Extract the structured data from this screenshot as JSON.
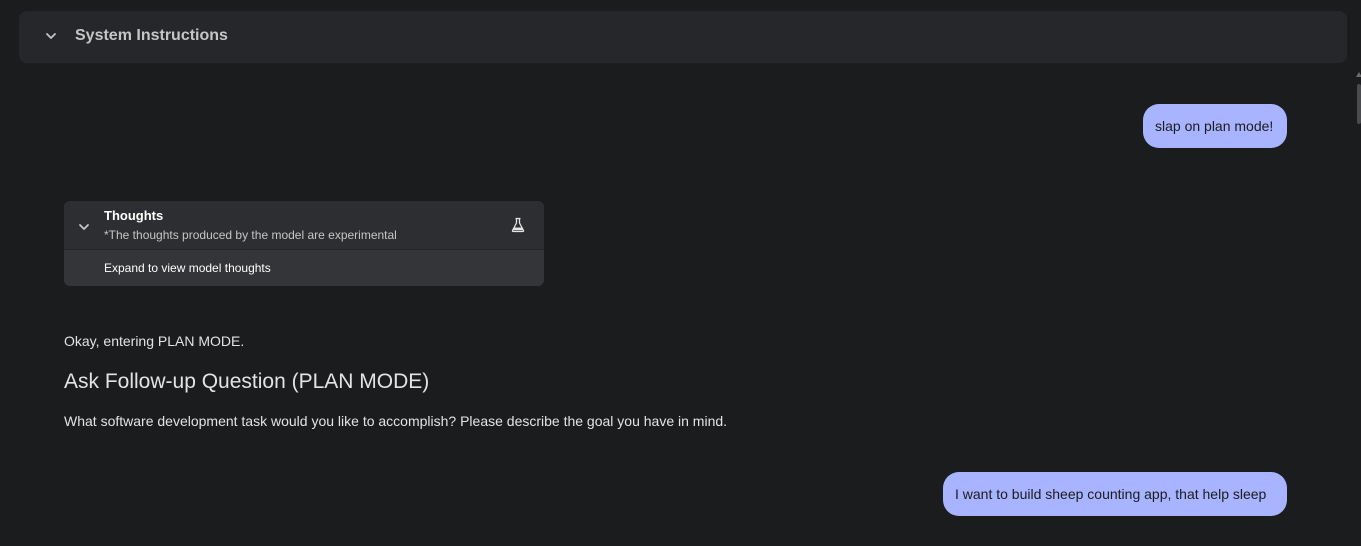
{
  "system_instructions": {
    "title": "System Instructions",
    "chevron_icon": "chevron-down-icon"
  },
  "messages": {
    "user_1": "slap on plan mode!",
    "thoughts": {
      "title": "Thoughts",
      "subtitle": "*The thoughts produced by the model are experimental",
      "expand_label": "Expand to view model thoughts",
      "icon": "flask-icon"
    },
    "model_1": {
      "intro": "Okay, entering PLAN MODE.",
      "heading": "Ask Follow-up Question (PLAN MODE)",
      "body": "What software development task would you like to accomplish? Please describe the goal you have in mind."
    },
    "user_2": "I want to build sheep counting app, that help sleep"
  },
  "colors": {
    "background": "#1b1c1e",
    "user_bubble": "#a8b4ff",
    "card": "#343538"
  }
}
